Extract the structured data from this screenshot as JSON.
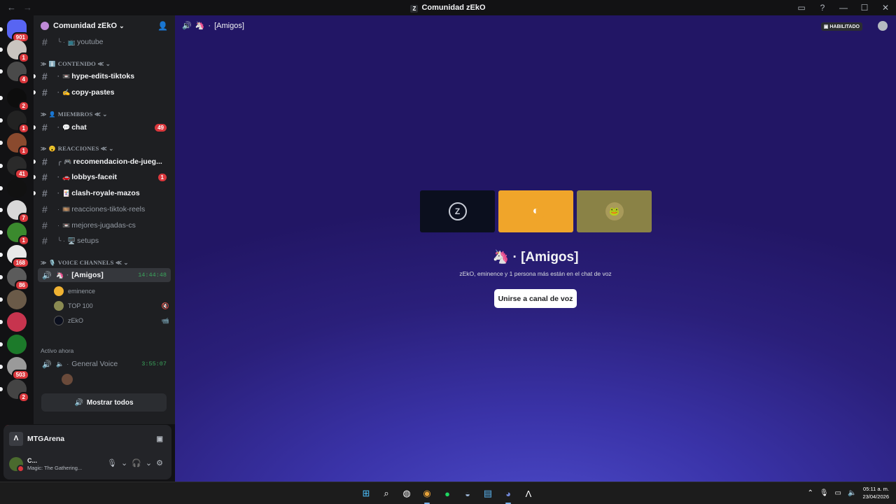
{
  "titlebar": {
    "title": "Comunidad zEkO",
    "back": "←",
    "forward": "→",
    "controls": [
      "▭",
      "?",
      "—",
      "☐",
      "✕"
    ]
  },
  "guilds": [
    {
      "badge": "901",
      "color": "#5865f2",
      "icon": "discord-home-icon"
    },
    {
      "badge": "1",
      "color": "#c9c4bf"
    },
    {
      "badge": "4",
      "color": "#4a4a4a"
    },
    {
      "badge": "2",
      "color": "#0d0d0d"
    },
    {
      "badge": "1",
      "color": "#222222"
    },
    {
      "badge": "1",
      "color": "#8a4a2e"
    },
    {
      "badge": "41",
      "color": "#2a2a2a"
    },
    {
      "badge": "",
      "color": "#111111"
    },
    {
      "badge": "7",
      "color": "#d8d8d8"
    },
    {
      "badge": "1",
      "color": "#3b8a2e"
    },
    {
      "badge": "168",
      "color": "#e8e8e8"
    },
    {
      "badge": "86",
      "color": "#5b5b5b"
    },
    {
      "badge": "",
      "color": "#6a5a48"
    },
    {
      "badge": "",
      "color": "#c7344e"
    },
    {
      "badge": "",
      "color": "#1c7a2a"
    },
    {
      "badge": "503",
      "color": "#9a9a9a"
    },
    {
      "badge": "2",
      "color": "#444444"
    }
  ],
  "nuevo": "NUEVO",
  "sidebar": {
    "server_name": "Comunidad zEkO",
    "channels_top": [
      {
        "name": "youtube",
        "icon": "📺",
        "unread": false,
        "thread": true
      }
    ],
    "categories": [
      {
        "name": "CONTENIDO",
        "icon": "ℹ️",
        "suffix": "≪ ⌄"
      },
      {
        "name": "MIEMBROS",
        "icon": "👤",
        "suffix": "≪ ⌄"
      },
      {
        "name": "REACCIONES",
        "icon": "😮",
        "suffix": "≪ ⌄"
      },
      {
        "name": "VOICE CHANNELS",
        "icon": "🎙️",
        "suffix": "≪ ⌄"
      }
    ],
    "channels": [
      {
        "name": "hype-edits-tiktoks",
        "icon": "📼",
        "unread": true
      },
      {
        "name": "copy-pastes",
        "icon": "✍️",
        "unread": true
      },
      {
        "name": "chat",
        "icon": "💬",
        "unread": true,
        "badge": "49"
      },
      {
        "name": "recomendacion-de-jueg...",
        "icon": "🎮",
        "unread": true
      },
      {
        "name": "lobbys-faceit",
        "icon": "🚗",
        "unread": true,
        "badge": "1"
      },
      {
        "name": "clash-royale-mazos",
        "icon": "🃏",
        "unread": true
      },
      {
        "name": "reacciones-tiktok-reels",
        "icon": "🎞️",
        "unread": false
      },
      {
        "name": "mejores-jugadas-cs",
        "icon": "📼",
        "unread": false
      },
      {
        "name": "setups",
        "icon": "🖥️",
        "unread": false
      }
    ],
    "voice_channel": {
      "name": "[Amigos]",
      "icon": "🦄",
      "timer": "14:44:48"
    },
    "voice_users": [
      {
        "name": "eminence",
        "color": "#f0b232",
        "right_icon": ""
      },
      {
        "name": "TOP 100",
        "color": "#8a8a52",
        "right_icon": "🔇"
      },
      {
        "name": "zEkO",
        "color": "#0b0f1e",
        "right_icon": "📹"
      }
    ],
    "activo_label": "Activo ahora",
    "active_voice": {
      "name": "General Voice",
      "timer": "3:55:07"
    },
    "mostrar_label": "Mostrar todos"
  },
  "panel": {
    "game": "MTGArena",
    "user_name": "C...",
    "user_status": "Magic: The Gathering..."
  },
  "main": {
    "channel_title": "[Amigos]",
    "habilitado": "HABILITADO",
    "subtitle": "zEkO, eminence y 1 persona más están en el chat de voz",
    "join_button": "Unirse a canal de voz",
    "tiles": [
      {
        "color": "#0b0f1e",
        "avatar_color": "#0b0f1e",
        "glyph": "Z"
      },
      {
        "color": "#f0a52a",
        "avatar_color": "#f0a52a",
        "glyph": "◐"
      },
      {
        "color": "#8a8246",
        "avatar_color": "#a89a5a",
        "glyph": "🐸"
      }
    ]
  },
  "taskbar": {
    "icons": [
      "start-icon",
      "search-icon",
      "tool-icon",
      "chrome-icon",
      "spotify-icon",
      "steam-icon",
      "notepad-icon",
      "discord-icon",
      "arena-icon"
    ],
    "time": "05:11 a. m.",
    "date": "23/04/2026"
  }
}
